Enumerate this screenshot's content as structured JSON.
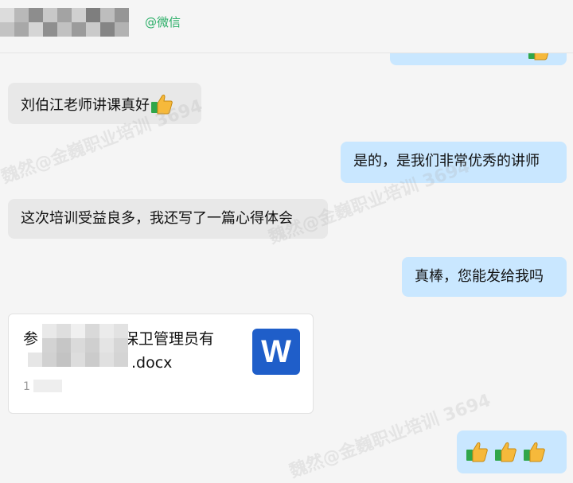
{
  "header": {
    "tag": "@微信",
    "mosaic_colors": [
      "#d6d6d6",
      "#9a9a9a",
      "#b5b5b5",
      "#7a7a7a",
      "#c4c4c4",
      "#8c8c8c",
      "#e0e0e0",
      "#6f6f6f",
      "#aaaaaa"
    ]
  },
  "messages": [
    {
      "side": "right",
      "text": "",
      "partial": true
    },
    {
      "side": "left",
      "text": "刘伯江老师讲课真好",
      "emoji": "thumbs-up"
    },
    {
      "side": "right",
      "text": "是的，是我们非常优秀的讲师"
    },
    {
      "side": "left",
      "text": "这次培训受益良多，我还写了一篇心得体会"
    },
    {
      "side": "right",
      "text": "真棒，您能发给我吗"
    }
  ],
  "file": {
    "name_line1": "的保卫管理员有",
    "name_line2": ".docx",
    "first_char": "参",
    "sub": "1",
    "icon_letter": "W",
    "icon_color": "#1f5ec9"
  },
  "last_message": {
    "side": "right",
    "emoji_count": 3
  },
  "watermarks": [
    "魏然@金巍职业培训 3694",
    "魏然@金巍职业培训 3694",
    "魏然@金巍职业培训 3694"
  ],
  "colors": {
    "left_bubble": "#e8e8e8",
    "right_bubble": "#c9e7ff",
    "background": "#f5f5f5",
    "tag": "#2aae67"
  }
}
